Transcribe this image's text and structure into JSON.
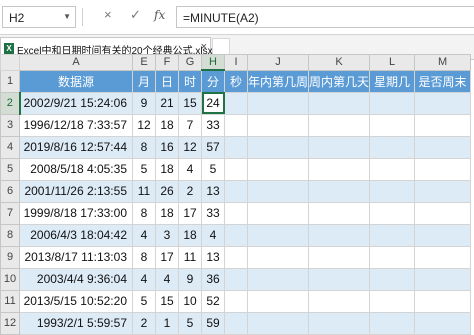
{
  "formula_bar": {
    "name_box": "H2",
    "cancel_icon": "×",
    "enter_icon": "✓",
    "fx_label": "fx",
    "formula": "=MINUTE(A2)"
  },
  "tab": {
    "icon_text": "X",
    "name": "Excel中和日期时间有关的20个经典公式.xlsx *",
    "close_icon": "×"
  },
  "columns": [
    "A",
    "E",
    "F",
    "G",
    "H",
    "I",
    "J",
    "K",
    "L",
    "M"
  ],
  "selected_column": "H",
  "selected_row": 2,
  "header_row": {
    "row_num": "1",
    "cells": [
      "数据源",
      "月",
      "日",
      "时",
      "分",
      "秒",
      "年内第几周",
      "周内第几天",
      "星期几",
      "是否周末"
    ]
  },
  "rows": [
    {
      "row_num": "2",
      "cells": [
        "2002/9/21  15:24:06",
        "9",
        "21",
        "15",
        "24",
        "",
        "",
        "",
        "",
        ""
      ]
    },
    {
      "row_num": "3",
      "cells": [
        "1996/12/18  7:33:57",
        "12",
        "18",
        "7",
        "33",
        "",
        "",
        "",
        "",
        ""
      ]
    },
    {
      "row_num": "4",
      "cells": [
        "2019/8/16  12:57:44",
        "8",
        "16",
        "12",
        "57",
        "",
        "",
        "",
        "",
        ""
      ]
    },
    {
      "row_num": "5",
      "cells": [
        "2008/5/18  4:05:35",
        "5",
        "18",
        "4",
        "5",
        "",
        "",
        "",
        "",
        ""
      ]
    },
    {
      "row_num": "6",
      "cells": [
        "2001/11/26  2:13:55",
        "11",
        "26",
        "2",
        "13",
        "",
        "",
        "",
        "",
        ""
      ]
    },
    {
      "row_num": "7",
      "cells": [
        "1999/8/18  17:33:00",
        "8",
        "18",
        "17",
        "33",
        "",
        "",
        "",
        "",
        ""
      ]
    },
    {
      "row_num": "8",
      "cells": [
        "2006/4/3  18:04:42",
        "4",
        "3",
        "18",
        "4",
        "",
        "",
        "",
        "",
        ""
      ]
    },
    {
      "row_num": "9",
      "cells": [
        "2013/8/17  11:13:03",
        "8",
        "17",
        "11",
        "13",
        "",
        "",
        "",
        "",
        ""
      ]
    },
    {
      "row_num": "10",
      "cells": [
        "2003/4/4  9:36:04",
        "4",
        "4",
        "9",
        "36",
        "",
        "",
        "",
        "",
        ""
      ]
    },
    {
      "row_num": "11",
      "cells": [
        "2013/5/15  10:52:20",
        "5",
        "15",
        "10",
        "52",
        "",
        "",
        "",
        "",
        ""
      ]
    },
    {
      "row_num": "12",
      "cells": [
        "1993/2/1  5:59:57",
        "2",
        "1",
        "5",
        "59",
        "",
        "",
        "",
        "",
        ""
      ]
    }
  ],
  "colors": {
    "header_fill": "#5b9bd5",
    "band_fill": "#ddebf7",
    "selection": "#217346"
  }
}
